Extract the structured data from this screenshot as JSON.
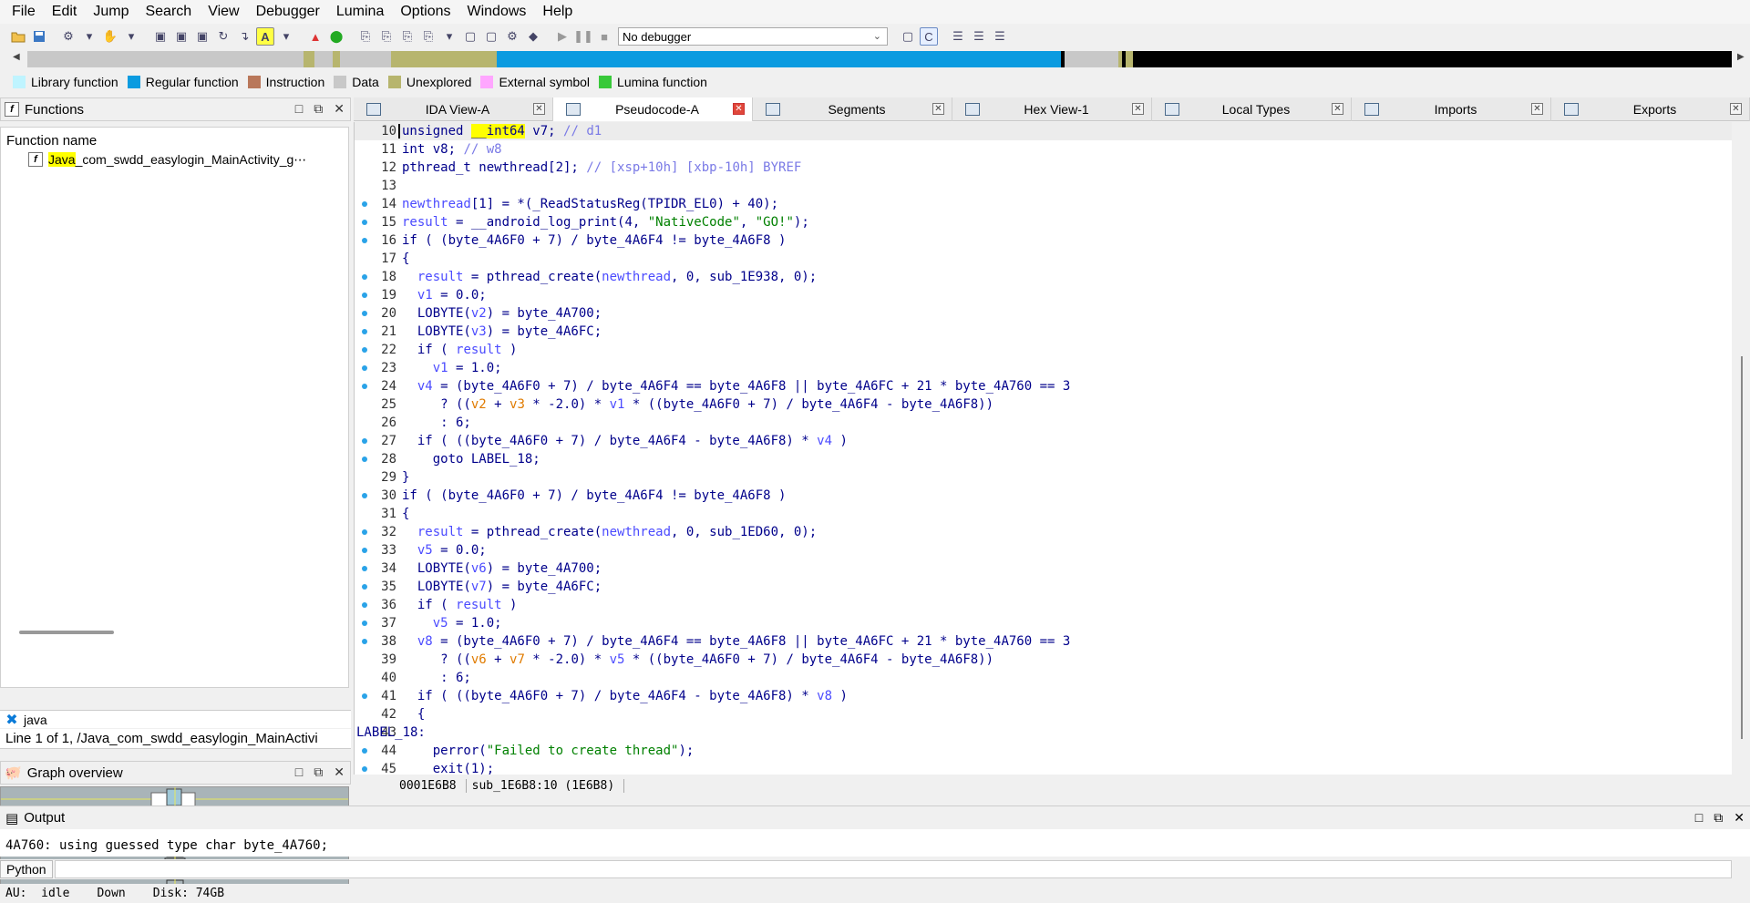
{
  "menu": [
    "File",
    "Edit",
    "Jump",
    "Search",
    "View",
    "Debugger",
    "Lumina",
    "Options",
    "Windows",
    "Help"
  ],
  "toolbar": {
    "debugger_value": "No debugger"
  },
  "legend": [
    {
      "label": "Library function",
      "color": "#bff4ff"
    },
    {
      "label": "Regular function",
      "color": "#0b9be0"
    },
    {
      "label": "Instruction",
      "color": "#b9775a"
    },
    {
      "label": "Data",
      "color": "#c8c8c8"
    },
    {
      "label": "Unexplored",
      "color": "#b7b56e"
    },
    {
      "label": "External symbol",
      "color": "#ffa6ff"
    },
    {
      "label": "Lumina function",
      "color": "#39c93a"
    }
  ],
  "functions_panel": {
    "title": "Functions",
    "column_header": "Function name",
    "row_highlight": "Java",
    "row_rest": "_com_swdd_easylogin_MainActivity_g⋯",
    "search_text": "java",
    "search_status": "Line 1 of 1, /Java_com_swdd_easylogin_MainActivi"
  },
  "graph_panel": {
    "title": "Graph overview"
  },
  "tabs": [
    {
      "label": "IDA View-A",
      "active": false
    },
    {
      "label": "Pseudocode-A",
      "active": true
    },
    {
      "label": "Segments",
      "active": false
    },
    {
      "label": "Hex View-1",
      "active": false
    },
    {
      "label": "Local Types",
      "active": false
    },
    {
      "label": "Imports",
      "active": false
    },
    {
      "label": "Exports",
      "active": false
    }
  ],
  "code_status": {
    "address": "0001E6B8",
    "location": "sub_1E6B8:10 (1E6B8)"
  },
  "output": {
    "title": "Output",
    "last_line": "4A760: using guessed type char byte_4A760;",
    "python_label": "Python"
  },
  "statusbar": {
    "au": "AU:",
    "state": "idle",
    "direction": "Down",
    "disk": "Disk: 74GB"
  }
}
